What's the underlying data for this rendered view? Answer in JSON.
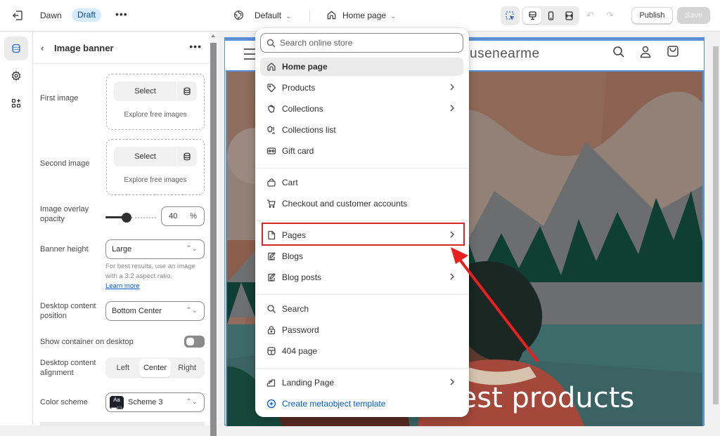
{
  "topbar": {
    "theme_name": "Dawn",
    "status_badge": "Draft",
    "more": "•••",
    "template_select": "Default",
    "page_select": "Home page",
    "publish_label": "Publish",
    "save_label": "Save"
  },
  "sidebar": {
    "back": "‹",
    "title": "Image banner",
    "more": "•••",
    "first_image": {
      "label": "First image",
      "select": "Select",
      "explore": "Explore free images"
    },
    "second_image": {
      "label": "Second image",
      "select": "Select",
      "explore": "Explore free images"
    },
    "overlay": {
      "label": "Image overlay opacity",
      "value": "40",
      "unit": "%",
      "percent": 40
    },
    "banner_height": {
      "label": "Banner height",
      "value": "Large",
      "help": "For best results, use an image with a 3:2 aspect ratio.",
      "help_link": "Learn more"
    },
    "content_position": {
      "label": "Desktop content position",
      "value": "Bottom Center"
    },
    "show_container": {
      "label": "Show container on desktop",
      "on": false
    },
    "alignment": {
      "label": "Desktop content alignment",
      "options": [
        "Left",
        "Center",
        "Right"
      ],
      "selected": "Center"
    },
    "color_scheme": {
      "label": "Color scheme",
      "value": "Scheme 3",
      "swatch": "Aa"
    }
  },
  "preview": {
    "store_name": "usenearme",
    "banner_heading": "test products"
  },
  "dropdown": {
    "search_placeholder": "Search online store",
    "groups": [
      [
        {
          "label": "Home page",
          "icon": "home-icon",
          "active": true,
          "submenu": false
        },
        {
          "label": "Products",
          "icon": "tag-icon",
          "submenu": true
        },
        {
          "label": "Collections",
          "icon": "collection-icon",
          "submenu": true
        },
        {
          "label": "Collections list",
          "icon": "collection-list-icon",
          "submenu": false
        },
        {
          "label": "Gift card",
          "icon": "gift-card-icon",
          "submenu": false
        }
      ],
      [
        {
          "label": "Cart",
          "icon": "bag-icon",
          "submenu": false
        },
        {
          "label": "Checkout and customer accounts",
          "icon": "cart-icon",
          "submenu": false
        }
      ],
      [
        {
          "label": "Pages",
          "icon": "page-icon",
          "submenu": true,
          "highlighted": true
        },
        {
          "label": "Blogs",
          "icon": "blog-icon",
          "submenu": false
        },
        {
          "label": "Blog posts",
          "icon": "blog-post-icon",
          "submenu": true
        }
      ],
      [
        {
          "label": "Search",
          "icon": "search-icon",
          "submenu": false
        },
        {
          "label": "Password",
          "icon": "lock-icon",
          "submenu": false
        },
        {
          "label": "404 page",
          "icon": "not-found-icon",
          "submenu": false
        }
      ],
      [
        {
          "label": "Landing Page",
          "icon": "landing-icon",
          "submenu": true
        },
        {
          "label": "Create metaobject template",
          "icon": "plus-circle-icon",
          "link": true
        }
      ]
    ]
  },
  "colors": {
    "accent": "#005bd3",
    "highlight": "#d6252b",
    "badge_bg": "#d5ebff",
    "frame": "#5b8fd9"
  }
}
